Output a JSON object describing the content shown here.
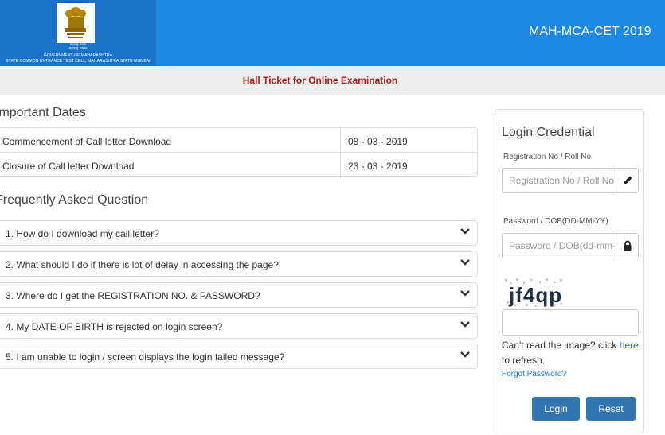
{
  "header": {
    "logo_hindi1": "महाराष्ट्र शासन",
    "logo_hindi2": "महाराष्ट्र शासन",
    "logo_line1": "GOVERNMENT OF MAHARASHTRA",
    "logo_line2": "STATE COMMON ENTRANCE TEST CELL, MAHARASHTRA STATE MUMBAI",
    "exam_title": "MAH-MCA-CET 2019",
    "bg_color": "#1e88e5"
  },
  "subbar": {
    "title": "Hall Ticket for Online Examination",
    "title_color": "#a81e1e"
  },
  "important_dates": {
    "heading": "Important Dates",
    "rows": [
      {
        "label": "Commencement of Call letter Download",
        "date": "08 - 03 - 2019"
      },
      {
        "label": "Closure of Call letter Download",
        "date": "23 - 03 - 2019"
      }
    ]
  },
  "faq": {
    "heading": "Frequently Asked Question",
    "items": [
      {
        "question": "1. How do I download my call letter?"
      },
      {
        "question": "2. What should I do if there is lot of delay in accessing the page?"
      },
      {
        "question": "3. Where do I get the REGISTRATION NO. & PASSWORD?"
      },
      {
        "question": "4. My DATE OF BIRTH is rejected on login screen?"
      },
      {
        "question": "5. I am unable to login / screen displays the login failed message?"
      }
    ],
    "expand_icon": "chevron-down-icon"
  },
  "login": {
    "title": "Login Credential",
    "registration_label": "Registration No / Roll No",
    "registration_placeholder": "Registration No / Roll No",
    "registration_icon": "pencil-icon",
    "password_label": "Password / DOB(DD-MM-YY)",
    "password_placeholder": "Password / DOB(dd-mm-yy)",
    "password_icon": "lock-icon",
    "captcha_text": "jf4qp",
    "refresh_prefix": "Can't read the image? click ",
    "refresh_link": "here",
    "refresh_suffix": " to refresh.",
    "forgot_password": "Forgot Password?",
    "login_button": "Login",
    "reset_button": "Reset",
    "button_color": "#3276b1"
  }
}
